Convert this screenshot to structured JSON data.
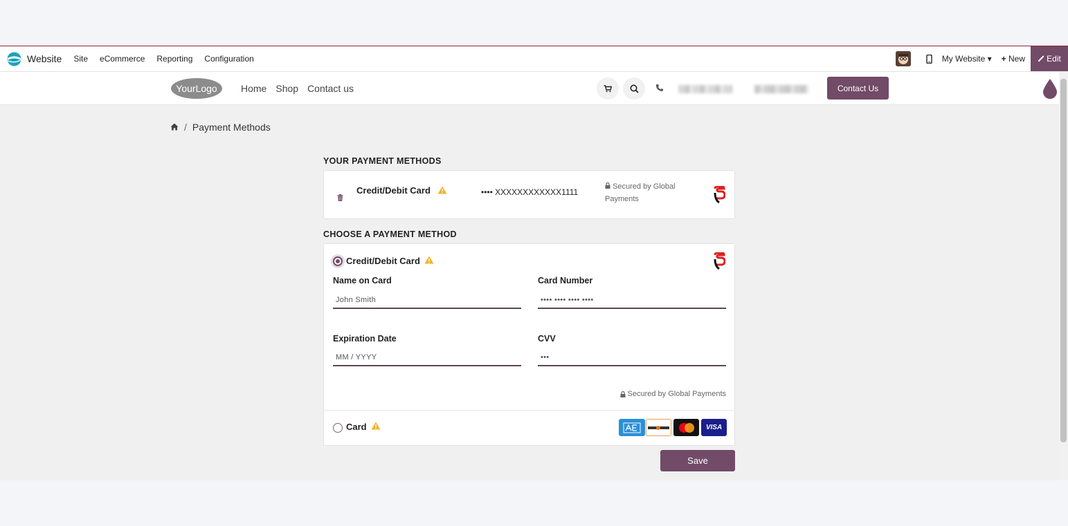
{
  "topbar": {
    "app_name": "Website",
    "menu": [
      "Site",
      "eCommerce",
      "Reporting",
      "Configuration"
    ],
    "my_website": "My Website",
    "new_label": "New",
    "edit_label": "Edit"
  },
  "header": {
    "logo_text": "YourLogo",
    "nav": [
      "Home",
      "Shop",
      "Contact us"
    ],
    "contact_button": "Contact Us"
  },
  "breadcrumb": {
    "current": "Payment Methods"
  },
  "saved_methods": {
    "title": "YOUR PAYMENT METHODS",
    "name": "Credit/Debit Card",
    "number": "•••• XXXXXXXXXXXX1111",
    "secured": "Secured by Global Payments"
  },
  "choose": {
    "title": "CHOOSE A PAYMENT METHOD",
    "option1": "Credit/Debit Card",
    "name_label": "Name on Card",
    "name_placeholder": "John Smith",
    "number_label": "Card Number",
    "number_placeholder": "•••• •••• •••• ••••",
    "expiry_label": "Expiration Date",
    "expiry_placeholder": "MM / YYYY",
    "cvv_label": "CVV",
    "cvv_placeholder": "•••",
    "secured": "Secured by Global Payments",
    "option2": "Card",
    "brands": {
      "visa": "VISA"
    }
  },
  "save_button": "Save",
  "colors": {
    "primary": "#714b67",
    "warning": "#f0b429"
  }
}
